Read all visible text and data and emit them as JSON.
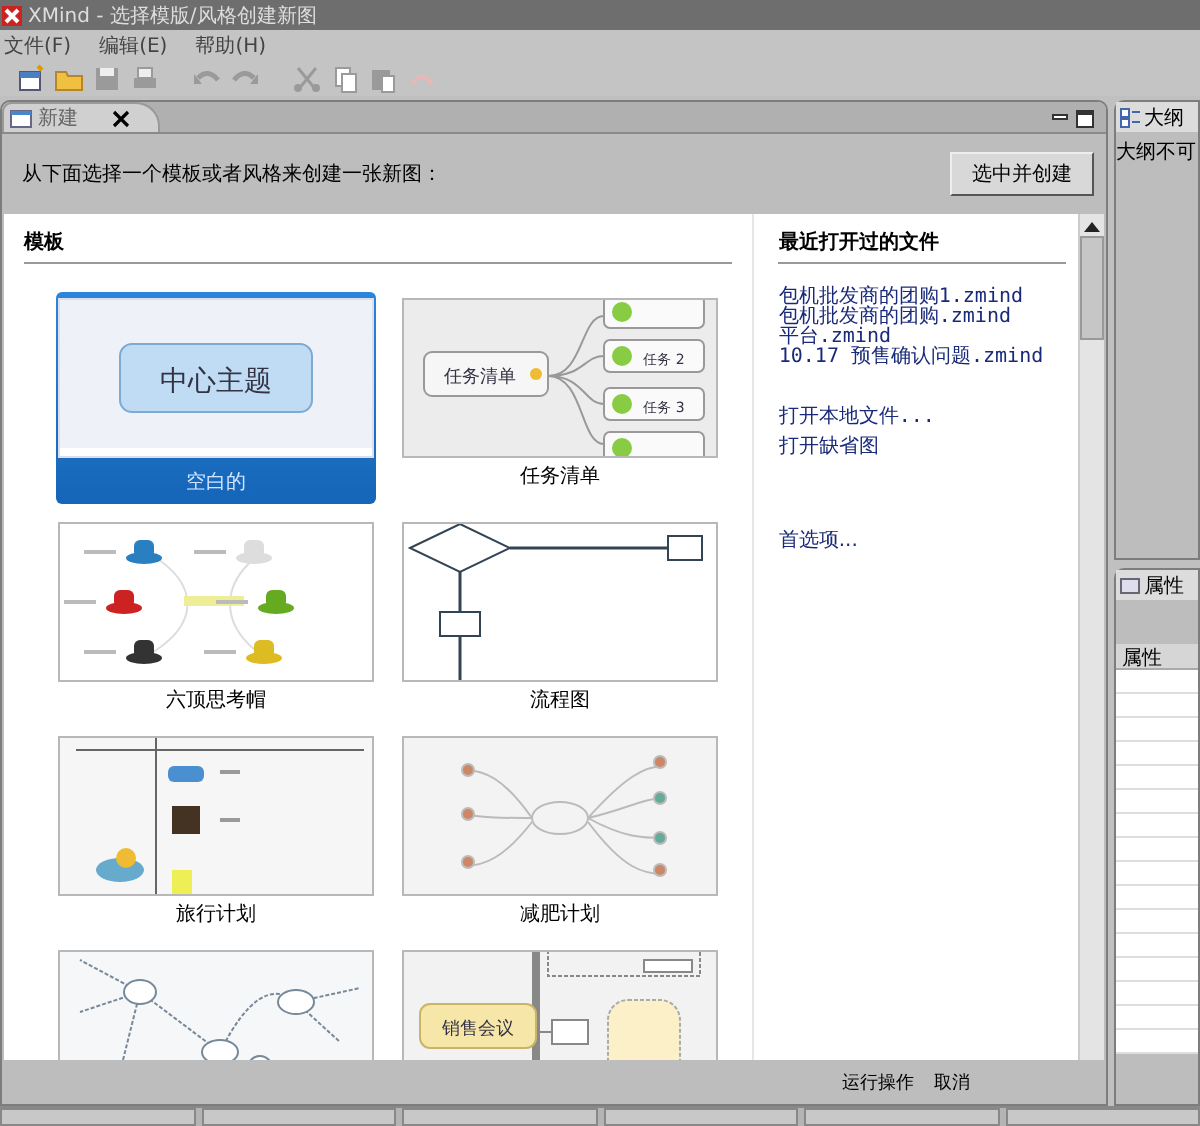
{
  "window": {
    "title": "XMind - 选择模版/风格创建新图"
  },
  "menu": [
    {
      "label": "文件(F)"
    },
    {
      "label": "编辑(E)"
    },
    {
      "label": "帮助(H)"
    }
  ],
  "toolbar": [
    {
      "kind": "new",
      "disabled": false
    },
    {
      "kind": "open",
      "disabled": false
    },
    {
      "kind": "save",
      "disabled": true
    },
    {
      "kind": "print",
      "disabled": true
    },
    {
      "kind": "undo",
      "disabled": true
    },
    {
      "kind": "redo",
      "disabled": true
    },
    {
      "kind": "cut",
      "disabled": true
    },
    {
      "kind": "copy",
      "disabled": true
    },
    {
      "kind": "paste",
      "disabled": true
    },
    {
      "kind": "delete",
      "disabled": true
    }
  ],
  "editor_tab": {
    "label": "新建"
  },
  "header": {
    "prompt": "从下面选择一个模板或者风格来创建一张新图：",
    "button": "选中并创建"
  },
  "templates": {
    "heading": "模板",
    "items": [
      {
        "kind": "central",
        "label": "空白的",
        "selected": true,
        "texts": [
          "中心主题"
        ]
      },
      {
        "kind": "tasks",
        "label": "任务清单",
        "selected": false,
        "texts": [
          "任务清单",
          "任务 2",
          "任务 3"
        ]
      },
      {
        "kind": "hats",
        "label": "六顶思考帽",
        "selected": false
      },
      {
        "kind": "flow",
        "label": "流程图",
        "selected": false
      },
      {
        "kind": "travel",
        "label": "旅行计划",
        "selected": false
      },
      {
        "kind": "diet",
        "label": "减肥计划",
        "selected": false
      },
      {
        "kind": "bubbles",
        "selected": false
      },
      {
        "kind": "sales",
        "selected": false,
        "texts": [
          "销售会议"
        ]
      }
    ]
  },
  "recent": {
    "heading": "最近打开过的文件",
    "files": [
      "包机批发商的团购1.zmind",
      "包机批发商的团购.zmind",
      "平台.zmind",
      "10.17 预售确认问题.zmind"
    ],
    "actions": [
      "打开本地文件...",
      "打开缺省图"
    ],
    "preferences": "首选项..."
  },
  "outline": {
    "tab": "大纲",
    "message": "大纲不可"
  },
  "properties": {
    "tab": "属性",
    "column": "属性"
  },
  "footer": {
    "buttons": [
      "运行操作",
      "取消"
    ]
  }
}
